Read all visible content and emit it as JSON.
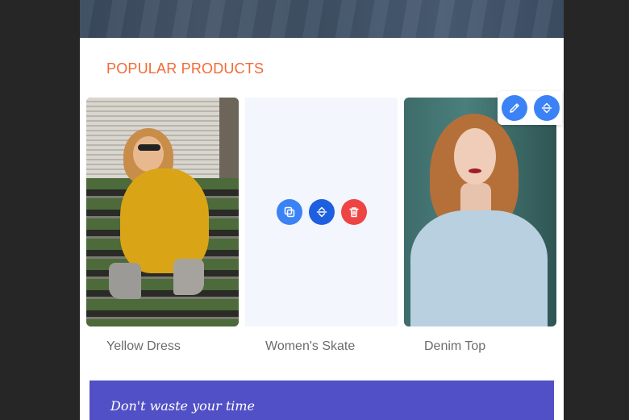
{
  "section": {
    "title": "POPULAR PRODUCTS"
  },
  "products": [
    {
      "name": "Yellow Dress"
    },
    {
      "name": "Women's Skate"
    },
    {
      "name": "Denim Top"
    }
  ],
  "card_controls": [
    "duplicate-icon",
    "move-icon",
    "trash-icon"
  ],
  "toolbar_controls": [
    "pencil-icon",
    "move-icon"
  ],
  "banner": {
    "text": "Don't waste your time"
  },
  "colors": {
    "accent": "#f26a36",
    "primary": "#3b82f6",
    "primary_dark": "#1d5fe0",
    "danger": "#ef4444",
    "banner": "#5150c6",
    "placeholder": "#f3f6fc"
  }
}
